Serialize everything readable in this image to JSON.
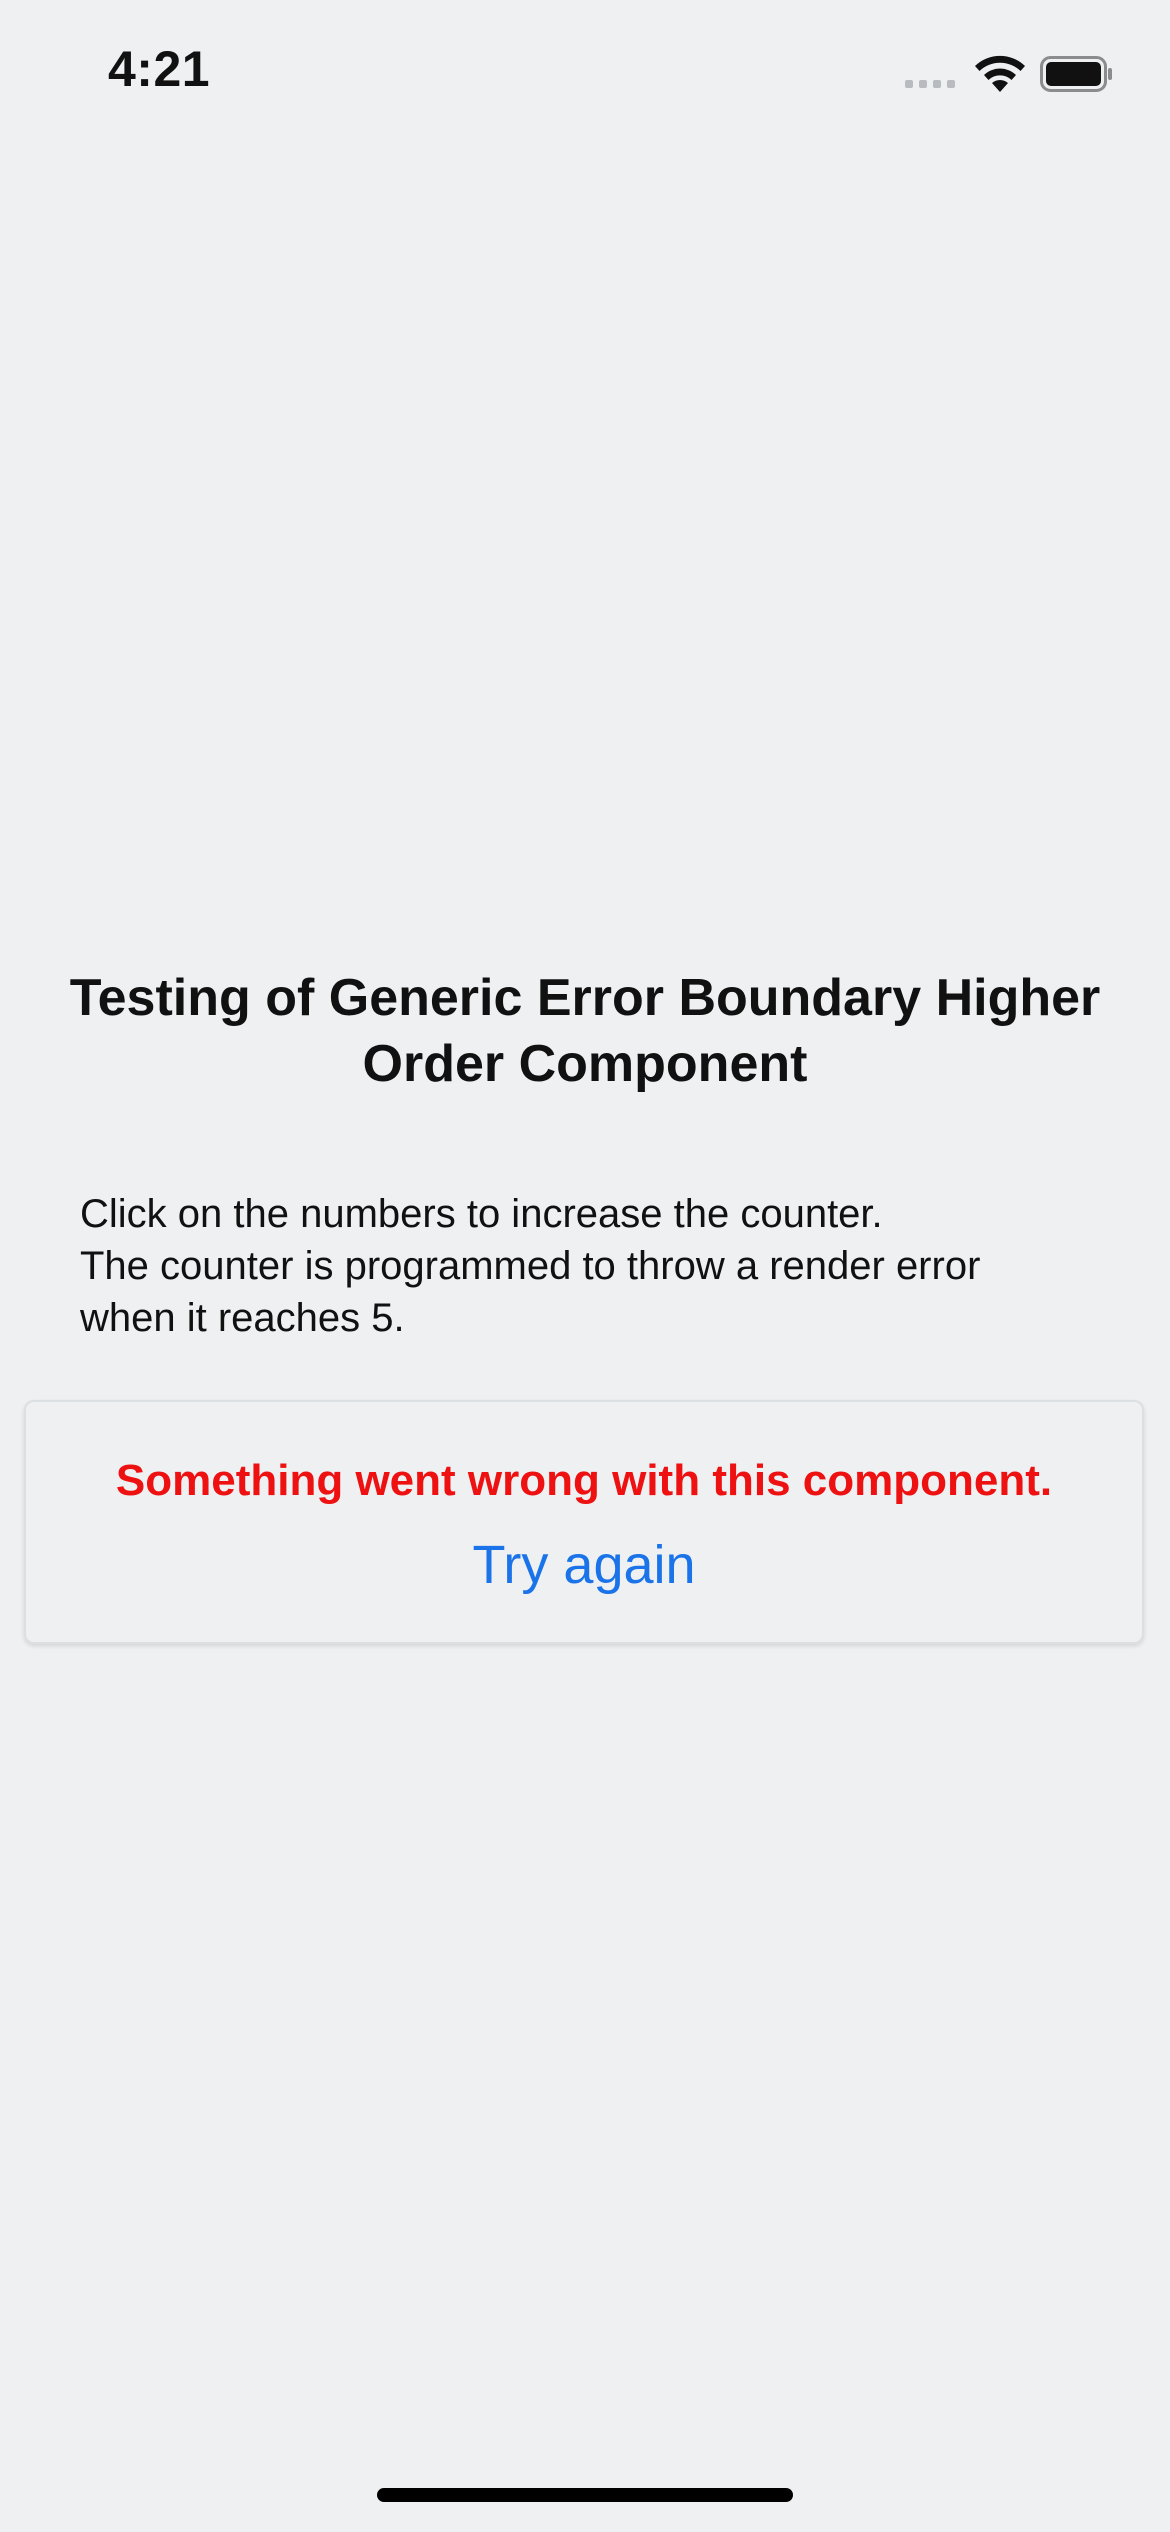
{
  "status_bar": {
    "time": "4:21",
    "icons": [
      "cellular-signal-icon",
      "wifi-icon",
      "battery-icon"
    ]
  },
  "main": {
    "title": "Testing of Generic Error Boundary Higher Order Component",
    "instructions": [
      "Click on the numbers to increase the counter.",
      "The counter is programmed to throw a render error",
      "when it reaches 5."
    ],
    "error_card": {
      "message": "Something went wrong with this component.",
      "retry_label": "Try again"
    }
  },
  "colors": {
    "background": "#eef0f2",
    "error_text": "#ee1111",
    "link": "#1a73e8",
    "text": "#111111"
  }
}
